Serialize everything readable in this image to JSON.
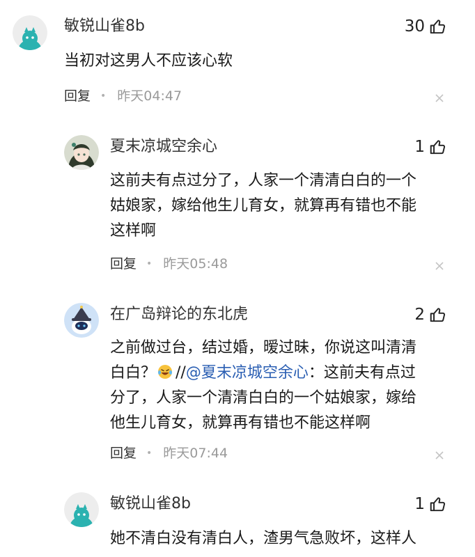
{
  "comments": [
    {
      "username": "敏锐山雀8b",
      "likes": "30",
      "text": "当初对这男人不应该心软",
      "reply_label": "回复",
      "time": "昨天04:47"
    },
    {
      "username": "夏末凉城空余心",
      "likes": "1",
      "text_lines": [
        "这前夫有点过分了，人家一个清清白白的一个",
        "姑娘家，嫁给他生儿育女，就算再有错也不能",
        "这样啊"
      ],
      "reply_label": "回复",
      "time": "昨天05:48"
    },
    {
      "username": "在广岛辩论的东北虎",
      "likes": "2",
      "line1": "之前做过台，结过婚，暧过昧，你说这叫清清",
      "line2_prefix": "白白？",
      "line2_slashes": "//",
      "line2_mention": "@夏末凉城空余心",
      "line2_rest": "：这前夫有点过",
      "line3": "分了，人家一个清清白白的一个姑娘家，嫁给",
      "line4": "他生儿育女，就算再有错也不能这样啊",
      "reply_label": "回复",
      "time": "昨天07:44"
    },
    {
      "username": "敏锐山雀8b",
      "likes": "1",
      "line1": "她不清白没有清白人，渣男气急败坏，这样人"
    }
  ],
  "icons": {
    "like": "thumbs-up-icon",
    "close": "close-icon",
    "emoji": "laughing-tears-emoji"
  },
  "colors": {
    "mention": "#2b5fb3",
    "time": "#9a9a9a",
    "avatar_teal": "#2bb2b0"
  }
}
